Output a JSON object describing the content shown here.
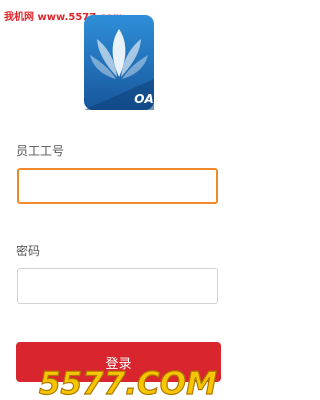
{
  "watermark": {
    "top_text": "我机网 www.5577.com",
    "bottom_text": "5577.COM"
  },
  "logo": {
    "badge_text": "OA"
  },
  "form": {
    "employee_id_label": "员工工号",
    "employee_id_value": "",
    "password_label": "密码",
    "password_value": "",
    "login_label": "登录"
  },
  "colors": {
    "accent": "#d9252e",
    "focus_border": "#ee8a2c",
    "logo_blue": "#1f6fb8"
  }
}
